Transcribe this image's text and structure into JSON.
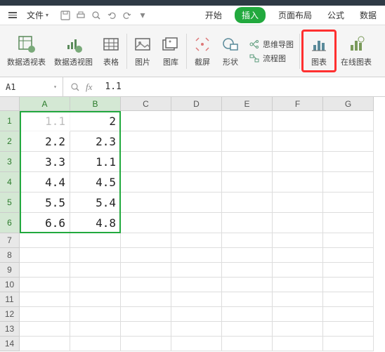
{
  "menu": {
    "file_label": "文件",
    "tabs": [
      "开始",
      "插入",
      "页面布局",
      "公式",
      "数据"
    ],
    "active_tab": "插入"
  },
  "ribbon": {
    "pivot_table": "数据透视表",
    "pivot_chart": "数据透视图",
    "table": "表格",
    "picture": "图片",
    "gallery": "图库",
    "screenshot": "截屏",
    "shapes": "形状",
    "mindmap": "思维导图",
    "flowchart": "流程图",
    "chart": "图表",
    "online_chart": "在线图表"
  },
  "cell_ref": "A1",
  "formula_value": "1.1",
  "columns": [
    "A",
    "B",
    "C",
    "D",
    "E",
    "F",
    "G"
  ],
  "selected_cols": [
    "A",
    "B"
  ],
  "row_count": 14,
  "selected_rows": [
    1,
    2,
    3,
    4,
    5,
    6
  ],
  "cells": {
    "1": {
      "A": "1.1",
      "B": "2"
    },
    "2": {
      "A": "2.2",
      "B": "2.3"
    },
    "3": {
      "A": "3.3",
      "B": "1.1"
    },
    "4": {
      "A": "4.4",
      "B": "4.5"
    },
    "5": {
      "A": "5.5",
      "B": "5.4"
    },
    "6": {
      "A": "6.6",
      "B": "4.8"
    }
  },
  "chart_data": {
    "type": "table",
    "columns": [
      "A",
      "B"
    ],
    "rows": [
      [
        1.1,
        2
      ],
      [
        2.2,
        2.3
      ],
      [
        3.3,
        1.1
      ],
      [
        4.4,
        4.5
      ],
      [
        5.5,
        5.4
      ],
      [
        6.6,
        4.8
      ]
    ]
  }
}
